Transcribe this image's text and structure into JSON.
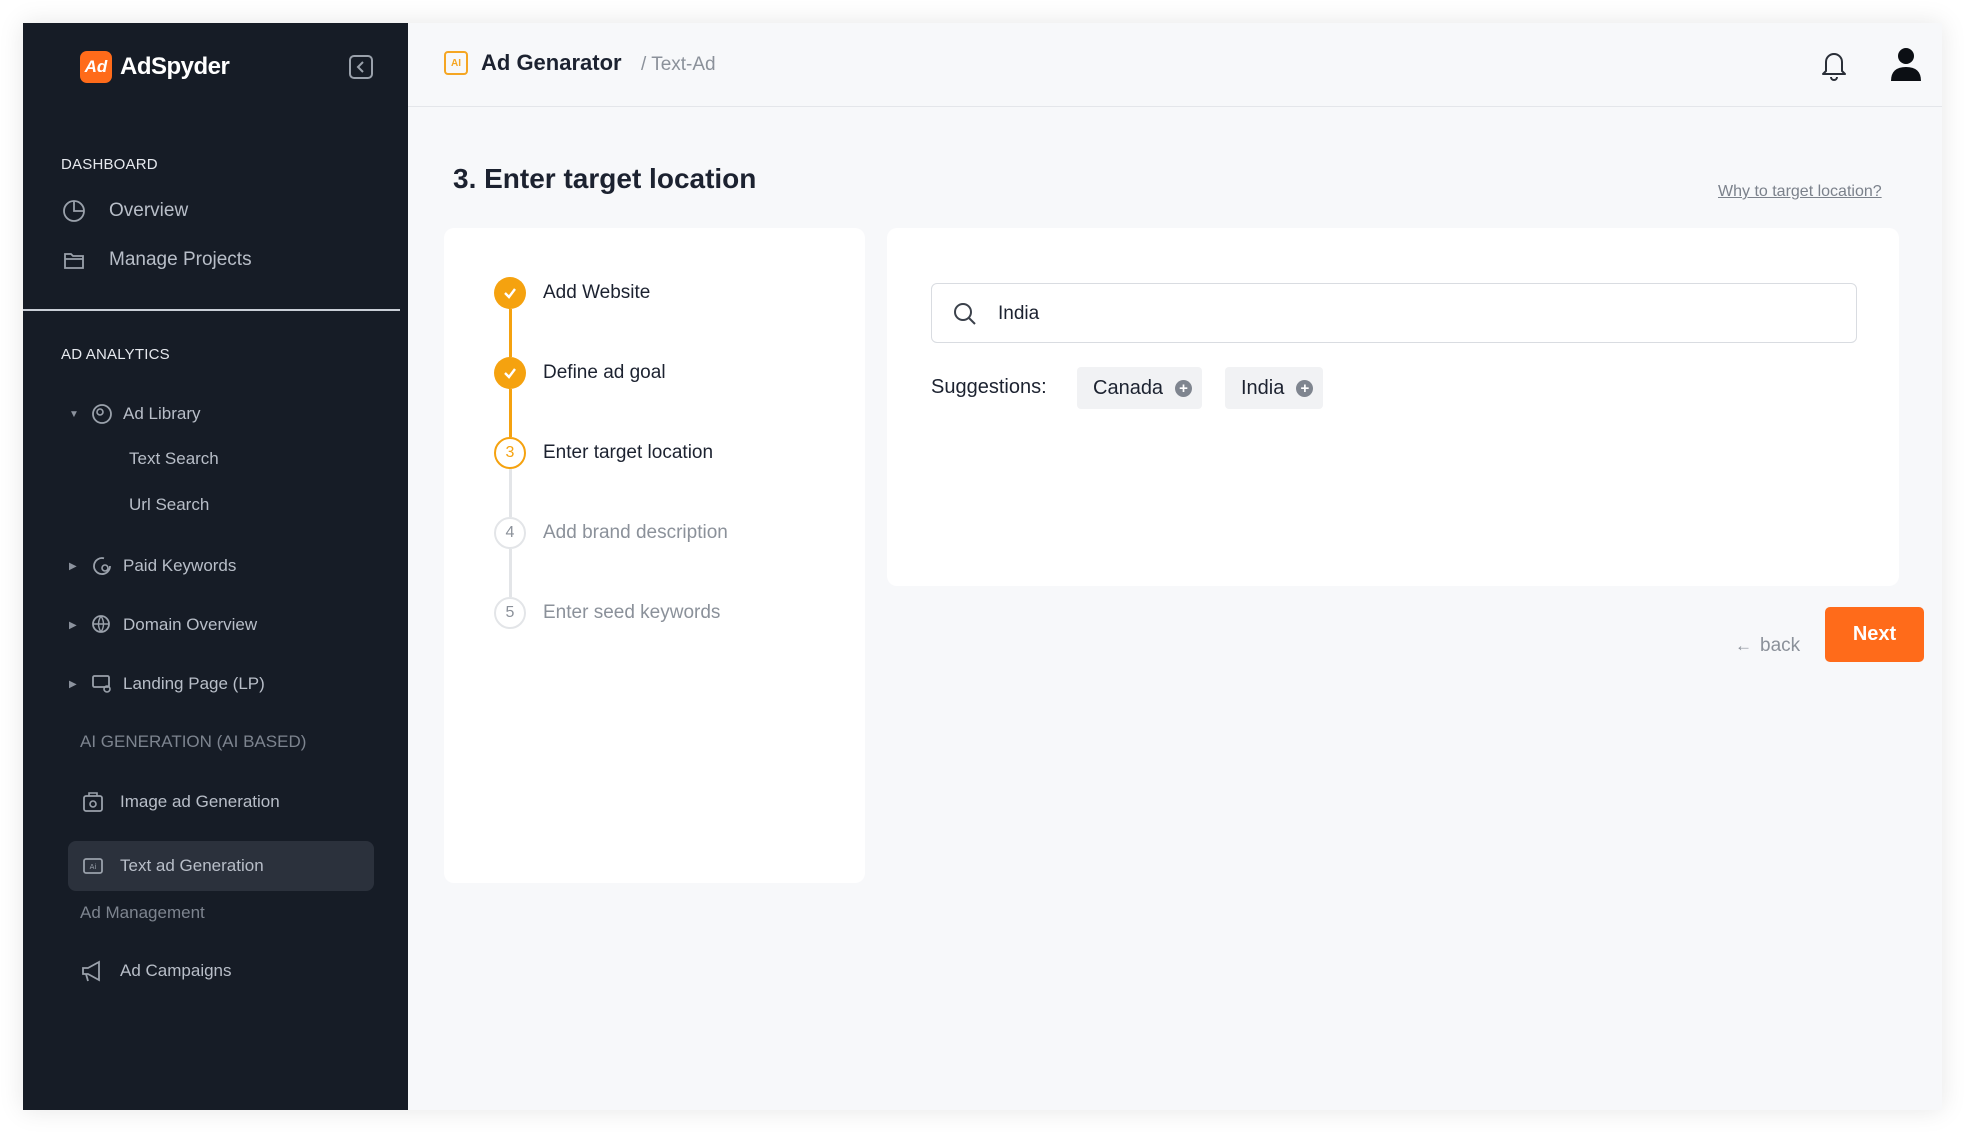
{
  "brand": {
    "name": "AdSpyder",
    "logo_text": "Ad"
  },
  "sidebar": {
    "dashboard_head": "DASHBOARD",
    "dashboard_items": [
      {
        "label": "Overview",
        "icon": "pie-chart-icon"
      },
      {
        "label": "Manage Projects",
        "icon": "folder-icon"
      }
    ],
    "analytics_head": "AD ANALYTICS",
    "ad_library": {
      "label": "Ad Library",
      "children": [
        "Text Search",
        "Url Search"
      ]
    },
    "paid_keywords": "Paid Keywords",
    "domain_overview": "Domain Overview",
    "landing_page": "Landing Page (LP)",
    "ai_generation_head": "AI GENERATION (AI BASED)",
    "image_ad_generation": "Image ad Generation",
    "text_ad_generation": "Text ad Generation",
    "ad_management_head": "Ad Management",
    "ad_campaigns": "Ad Campaigns"
  },
  "header": {
    "icon_text": "AI",
    "title": "Ad Genarator",
    "breadcrumb": "/ Text-Ad"
  },
  "main": {
    "page_title": "3. Enter target location",
    "help_link": "Why to target location?",
    "steps": [
      {
        "num": "",
        "label": "Add Website",
        "state": "done"
      },
      {
        "num": "",
        "label": "Define ad goal",
        "state": "done"
      },
      {
        "num": "3",
        "label": "Enter target location",
        "state": "current"
      },
      {
        "num": "4",
        "label": "Add brand description",
        "state": "todo"
      },
      {
        "num": "5",
        "label": "Enter seed keywords",
        "state": "todo"
      }
    ],
    "search_value": "India",
    "suggestions_label": "Suggestions:",
    "suggestions": [
      "Canada",
      "India"
    ],
    "back_label": "back",
    "next_label": "Next"
  },
  "colors": {
    "accent": "#ff6b1a",
    "step_accent": "#f5a20f",
    "sidebar_bg": "#161c26"
  }
}
